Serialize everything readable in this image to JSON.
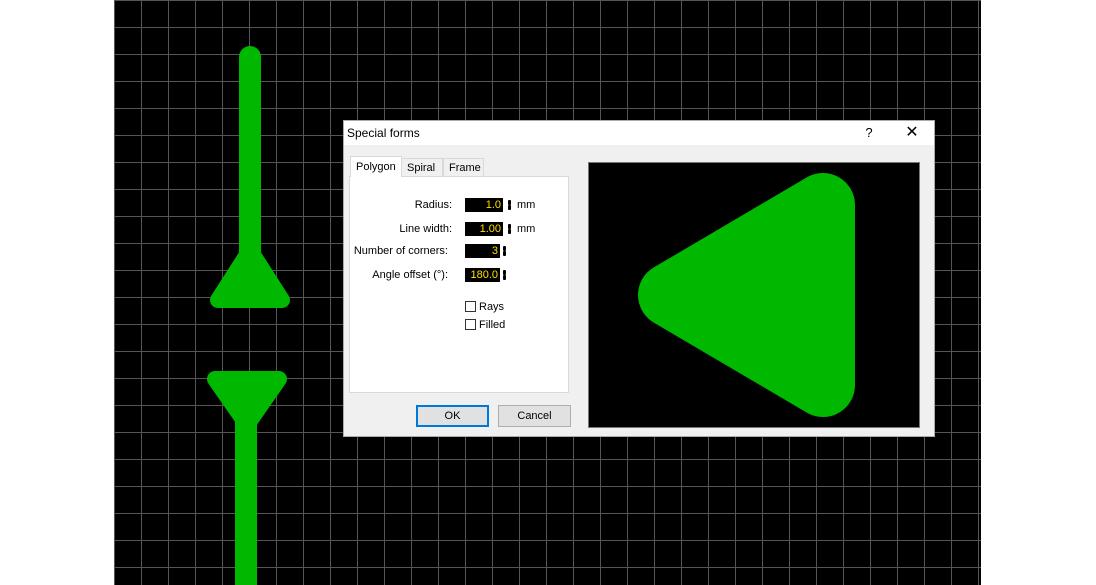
{
  "dialog": {
    "title": "Special forms",
    "help_label": "?",
    "close_label": "✕"
  },
  "tabs": [
    {
      "label": "Polygon",
      "active": true
    },
    {
      "label": "Spiral",
      "active": false
    },
    {
      "label": "Frame",
      "active": false
    }
  ],
  "fields": {
    "radius": {
      "label": "Radius:",
      "value": "1.0",
      "unit": "mm"
    },
    "line_width": {
      "label": "Line width:",
      "value": "1.00",
      "unit": "mm"
    },
    "corners": {
      "label": "Number of corners:",
      "value": "3"
    },
    "angle_offset": {
      "label": "Angle offset (°):",
      "value": "180.0"
    }
  },
  "checkboxes": {
    "rays": {
      "label": "Rays",
      "checked": false
    },
    "filled": {
      "label": "Filled",
      "checked": false
    }
  },
  "buttons": {
    "ok": "OK",
    "cancel": "Cancel"
  },
  "colors": {
    "track_green": "#00b800",
    "field_text": "#ffe000",
    "canvas_bg": "#000000",
    "grid": "#555555"
  }
}
